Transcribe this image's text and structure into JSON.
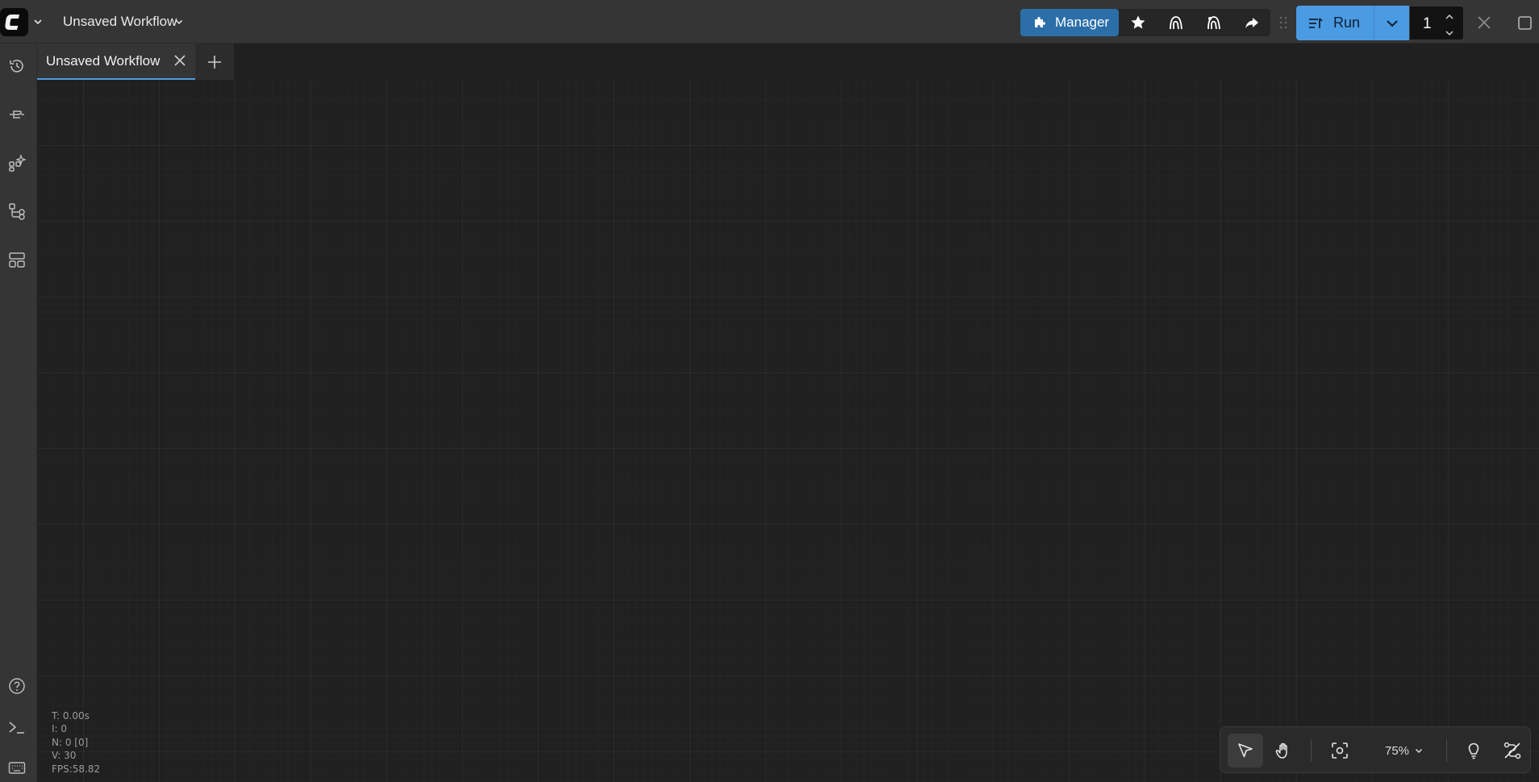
{
  "topbar": {
    "logo": "comfy-logo-icon",
    "workflow_title": "Unsaved Workflow",
    "manager_label": "Manager",
    "run_label": "Run",
    "batch_count": "1"
  },
  "tabs": [
    {
      "label": "Unsaved Workflow",
      "active": true
    }
  ],
  "sidebar": {
    "top_items": [
      "history-icon",
      "model-library-icon",
      "node-library-icon",
      "workflows-icon",
      "templates-icon"
    ],
    "bottom_items": [
      "help-icon",
      "terminal-icon",
      "keyboard-shortcuts-icon"
    ]
  },
  "canvas": {
    "stats": {
      "t": "T: 0.00s",
      "i": "I: 0",
      "n": "N: 0 [0]",
      "v": "V: 30",
      "fps": "FPS:58.82"
    }
  },
  "canvas_toolbar": {
    "zoom_label": "75%"
  },
  "colors": {
    "accent": "#4b9be3",
    "manager_bg": "#2b6ea8",
    "bar_bg": "#353535",
    "canvas_bg": "#202020"
  }
}
